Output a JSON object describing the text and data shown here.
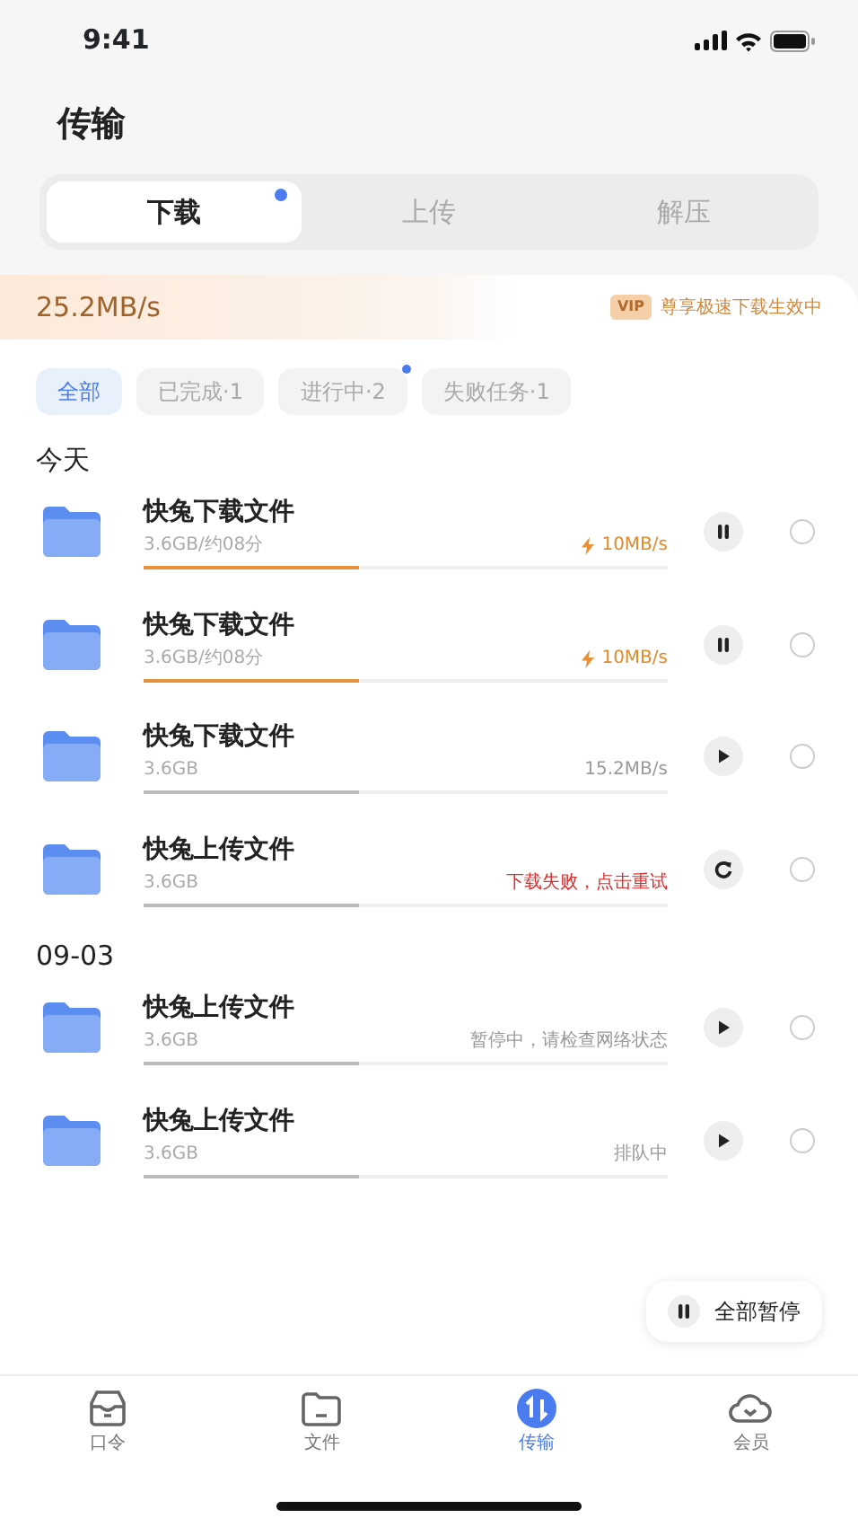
{
  "status_bar": {
    "time": "9:41"
  },
  "title": "传输",
  "tabs": [
    {
      "label": "下载",
      "selected": true,
      "dot": true
    },
    {
      "label": "上传",
      "selected": false,
      "dot": false
    },
    {
      "label": "解压",
      "selected": false,
      "dot": false
    }
  ],
  "speed_banner": {
    "speed": "25.2MB/s",
    "vip_badge": "VIP",
    "vip_text": "尊享极速下载生效中"
  },
  "filters": [
    {
      "label": "全部",
      "selected": true,
      "dot": false
    },
    {
      "label": "已完成·1",
      "selected": false,
      "dot": false
    },
    {
      "label": "进行中·2",
      "selected": false,
      "dot": true
    },
    {
      "label": "失败任务·1",
      "selected": false,
      "dot": false
    }
  ],
  "sections": [
    {
      "heading": "今天",
      "items": [
        {
          "name": "快兔下载文件",
          "size": "3.6GB/约08分",
          "status": "10MB/s",
          "kind": "boosted",
          "level": 0.41,
          "checked": false
        },
        {
          "name": "快兔下载文件",
          "size": "3.6GB/约08分",
          "status": "10MB/s",
          "kind": "boosted",
          "level": 0.41,
          "checked": false
        },
        {
          "name": "快兔下载文件",
          "size": "3.6GB",
          "status": "15.2MB/s",
          "kind": "paused",
          "level": 0.41,
          "checked": false
        },
        {
          "name": "快兔上传文件",
          "size": "3.6GB",
          "status": "下载失败，点击重试",
          "kind": "failed",
          "level": 0.41,
          "checked": false
        }
      ]
    },
    {
      "heading": "09-03",
      "items": [
        {
          "name": "快兔上传文件",
          "size": "3.6GB",
          "status": "暂停中，请检查网络状态",
          "kind": "paused",
          "level": 0.41,
          "checked": false
        },
        {
          "name": "快兔上传文件",
          "size": "3.6GB",
          "status": "排队中",
          "kind": "paused",
          "level": 0.41,
          "checked": false
        }
      ]
    }
  ],
  "pause_all": {
    "label": "全部暂停"
  },
  "bottom_nav": [
    {
      "label": "口令",
      "selected": false
    },
    {
      "label": "文件",
      "selected": false
    },
    {
      "label": "传输",
      "selected": true
    },
    {
      "label": "会员",
      "selected": false
    }
  ]
}
